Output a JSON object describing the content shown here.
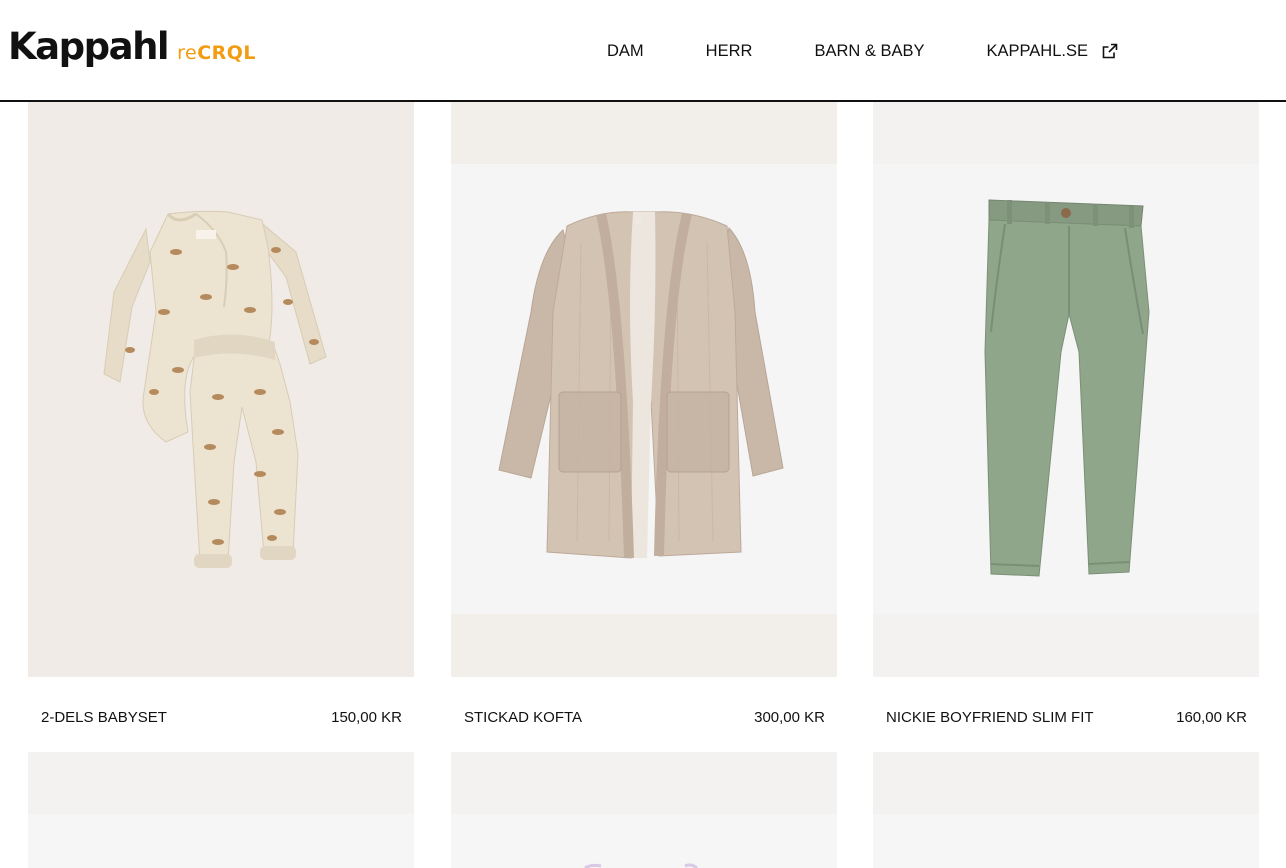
{
  "header": {
    "logo_main": "Kappahl",
    "logo_prefix": "re",
    "logo_suffix": "CRQL",
    "nav": [
      "DAM",
      "HERR",
      "BARN & BABY",
      "KAPPAHL.SE"
    ],
    "external_link_icon": "external-link-icon"
  },
  "colors": {
    "accent": "#f39c12",
    "text": "#111111",
    "card_bg_warm": "#f0ebe6",
    "card_bg_light": "#f5f5f6"
  },
  "products": [
    {
      "name": "2-DELS BABYSET",
      "price": "150,00 KR",
      "image": "baby-set-image"
    },
    {
      "name": "STICKAD KOFTA",
      "price": "300,00 KR",
      "image": "knitted-cardigan-image"
    },
    {
      "name": "NICKIE BOYFRIEND SLIM FIT",
      "price": "160,00 KR",
      "image": "green-trousers-image"
    },
    {
      "image": "product-image"
    },
    {
      "image": "product-image"
    },
    {
      "image": "product-image"
    }
  ]
}
